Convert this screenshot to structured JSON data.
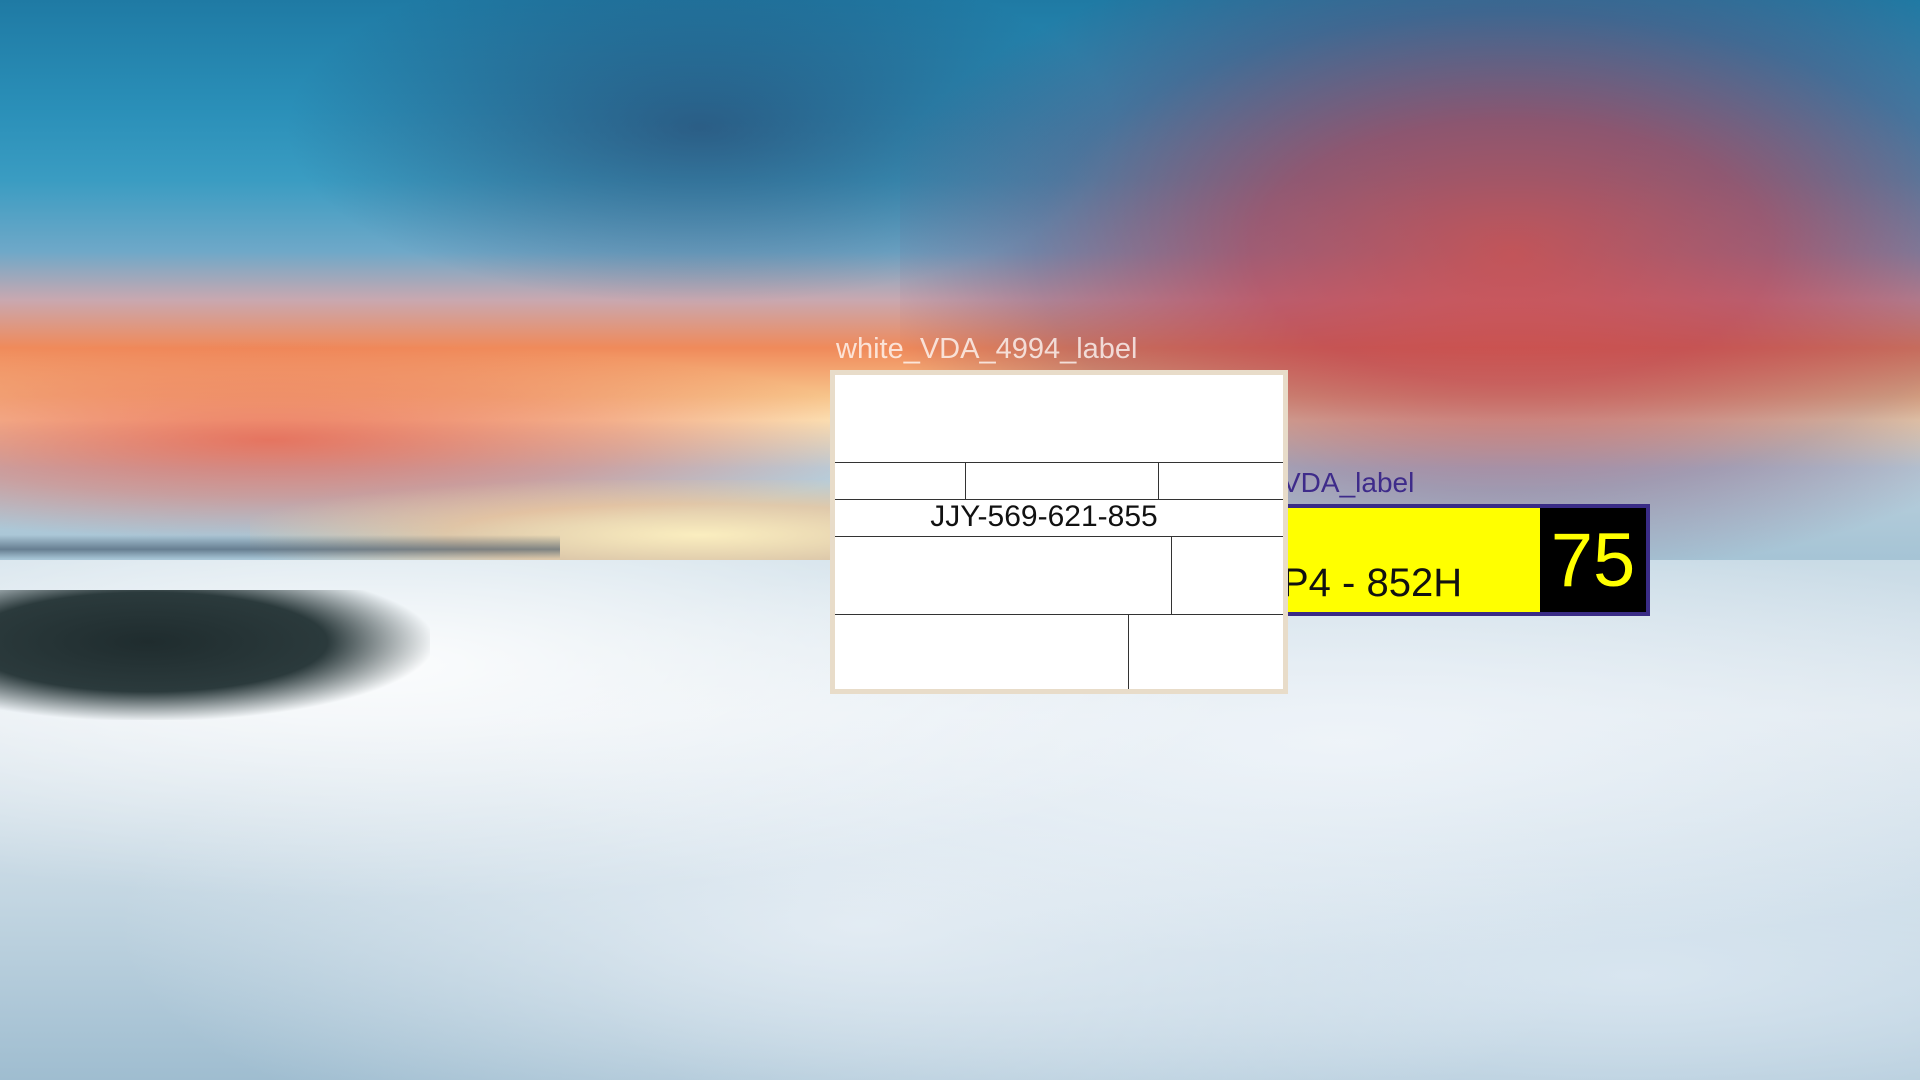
{
  "background": {
    "scene": "sunset sky above a sea of clouds"
  },
  "white_label": {
    "caption": "white_VDA_4994_label",
    "code": "JJY-569-621-855"
  },
  "yellow_label": {
    "caption": "VDA_label",
    "code": "P4 - 852H",
    "number": "75",
    "colors": {
      "fill": "#ffff00",
      "border": "#3a2c86",
      "number_bg": "#000000",
      "number_text": "#ffff00"
    }
  }
}
